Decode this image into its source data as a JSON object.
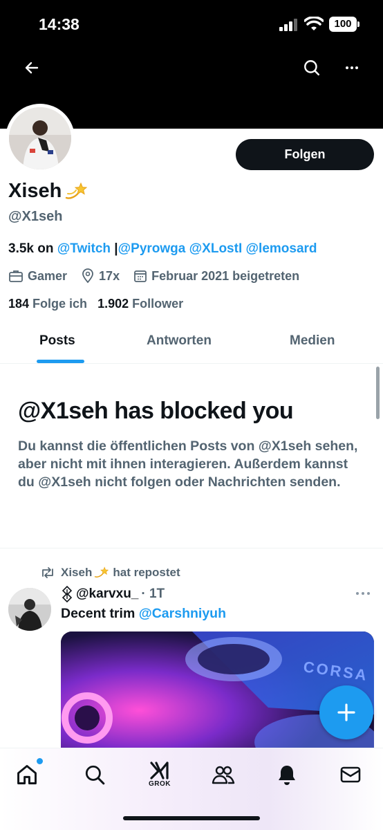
{
  "status_bar": {
    "time": "14:38",
    "battery": "100"
  },
  "profile": {
    "name": "Xiseh",
    "name_emoji": "dizzy-star-emoji",
    "handle": "@X1seh",
    "follow_label": "Folgen",
    "bio": {
      "prefix": "3.5k on ",
      "twitch": "@Twitch",
      "sep": " |",
      "mentions": [
        "@Pyrowga",
        "@XLostI",
        "@lemosard"
      ]
    },
    "meta": {
      "category": "Gamer",
      "location": "17x",
      "joined": "Februar 2021 beigetreten"
    },
    "stats": {
      "following_count": "184",
      "following_label": "Folge ich",
      "followers_count": "1.902",
      "followers_label": "Follower"
    }
  },
  "tabs": [
    "Posts",
    "Antworten",
    "Medien"
  ],
  "blocked": {
    "title": "@X1seh has blocked you",
    "text": "Du kannst die öffentlichen Posts von @X1seh sehen, aber nicht mit ihnen interagieren. Außerdem kannst du @X1seh nicht folgen oder Nachrichten senden."
  },
  "post": {
    "repost_name": "Xiseh",
    "repost_suffix": "hat repostet",
    "author_handle": "@karvxu_",
    "time": "· 1T",
    "text": "Decent trim ",
    "mention": "@Carshniyuh",
    "media_text": "CORSA"
  },
  "nav": {
    "grok_label": "GROK"
  },
  "colors": {
    "accent": "#1d9bf0",
    "text": "#0f1419",
    "muted": "#536471"
  }
}
